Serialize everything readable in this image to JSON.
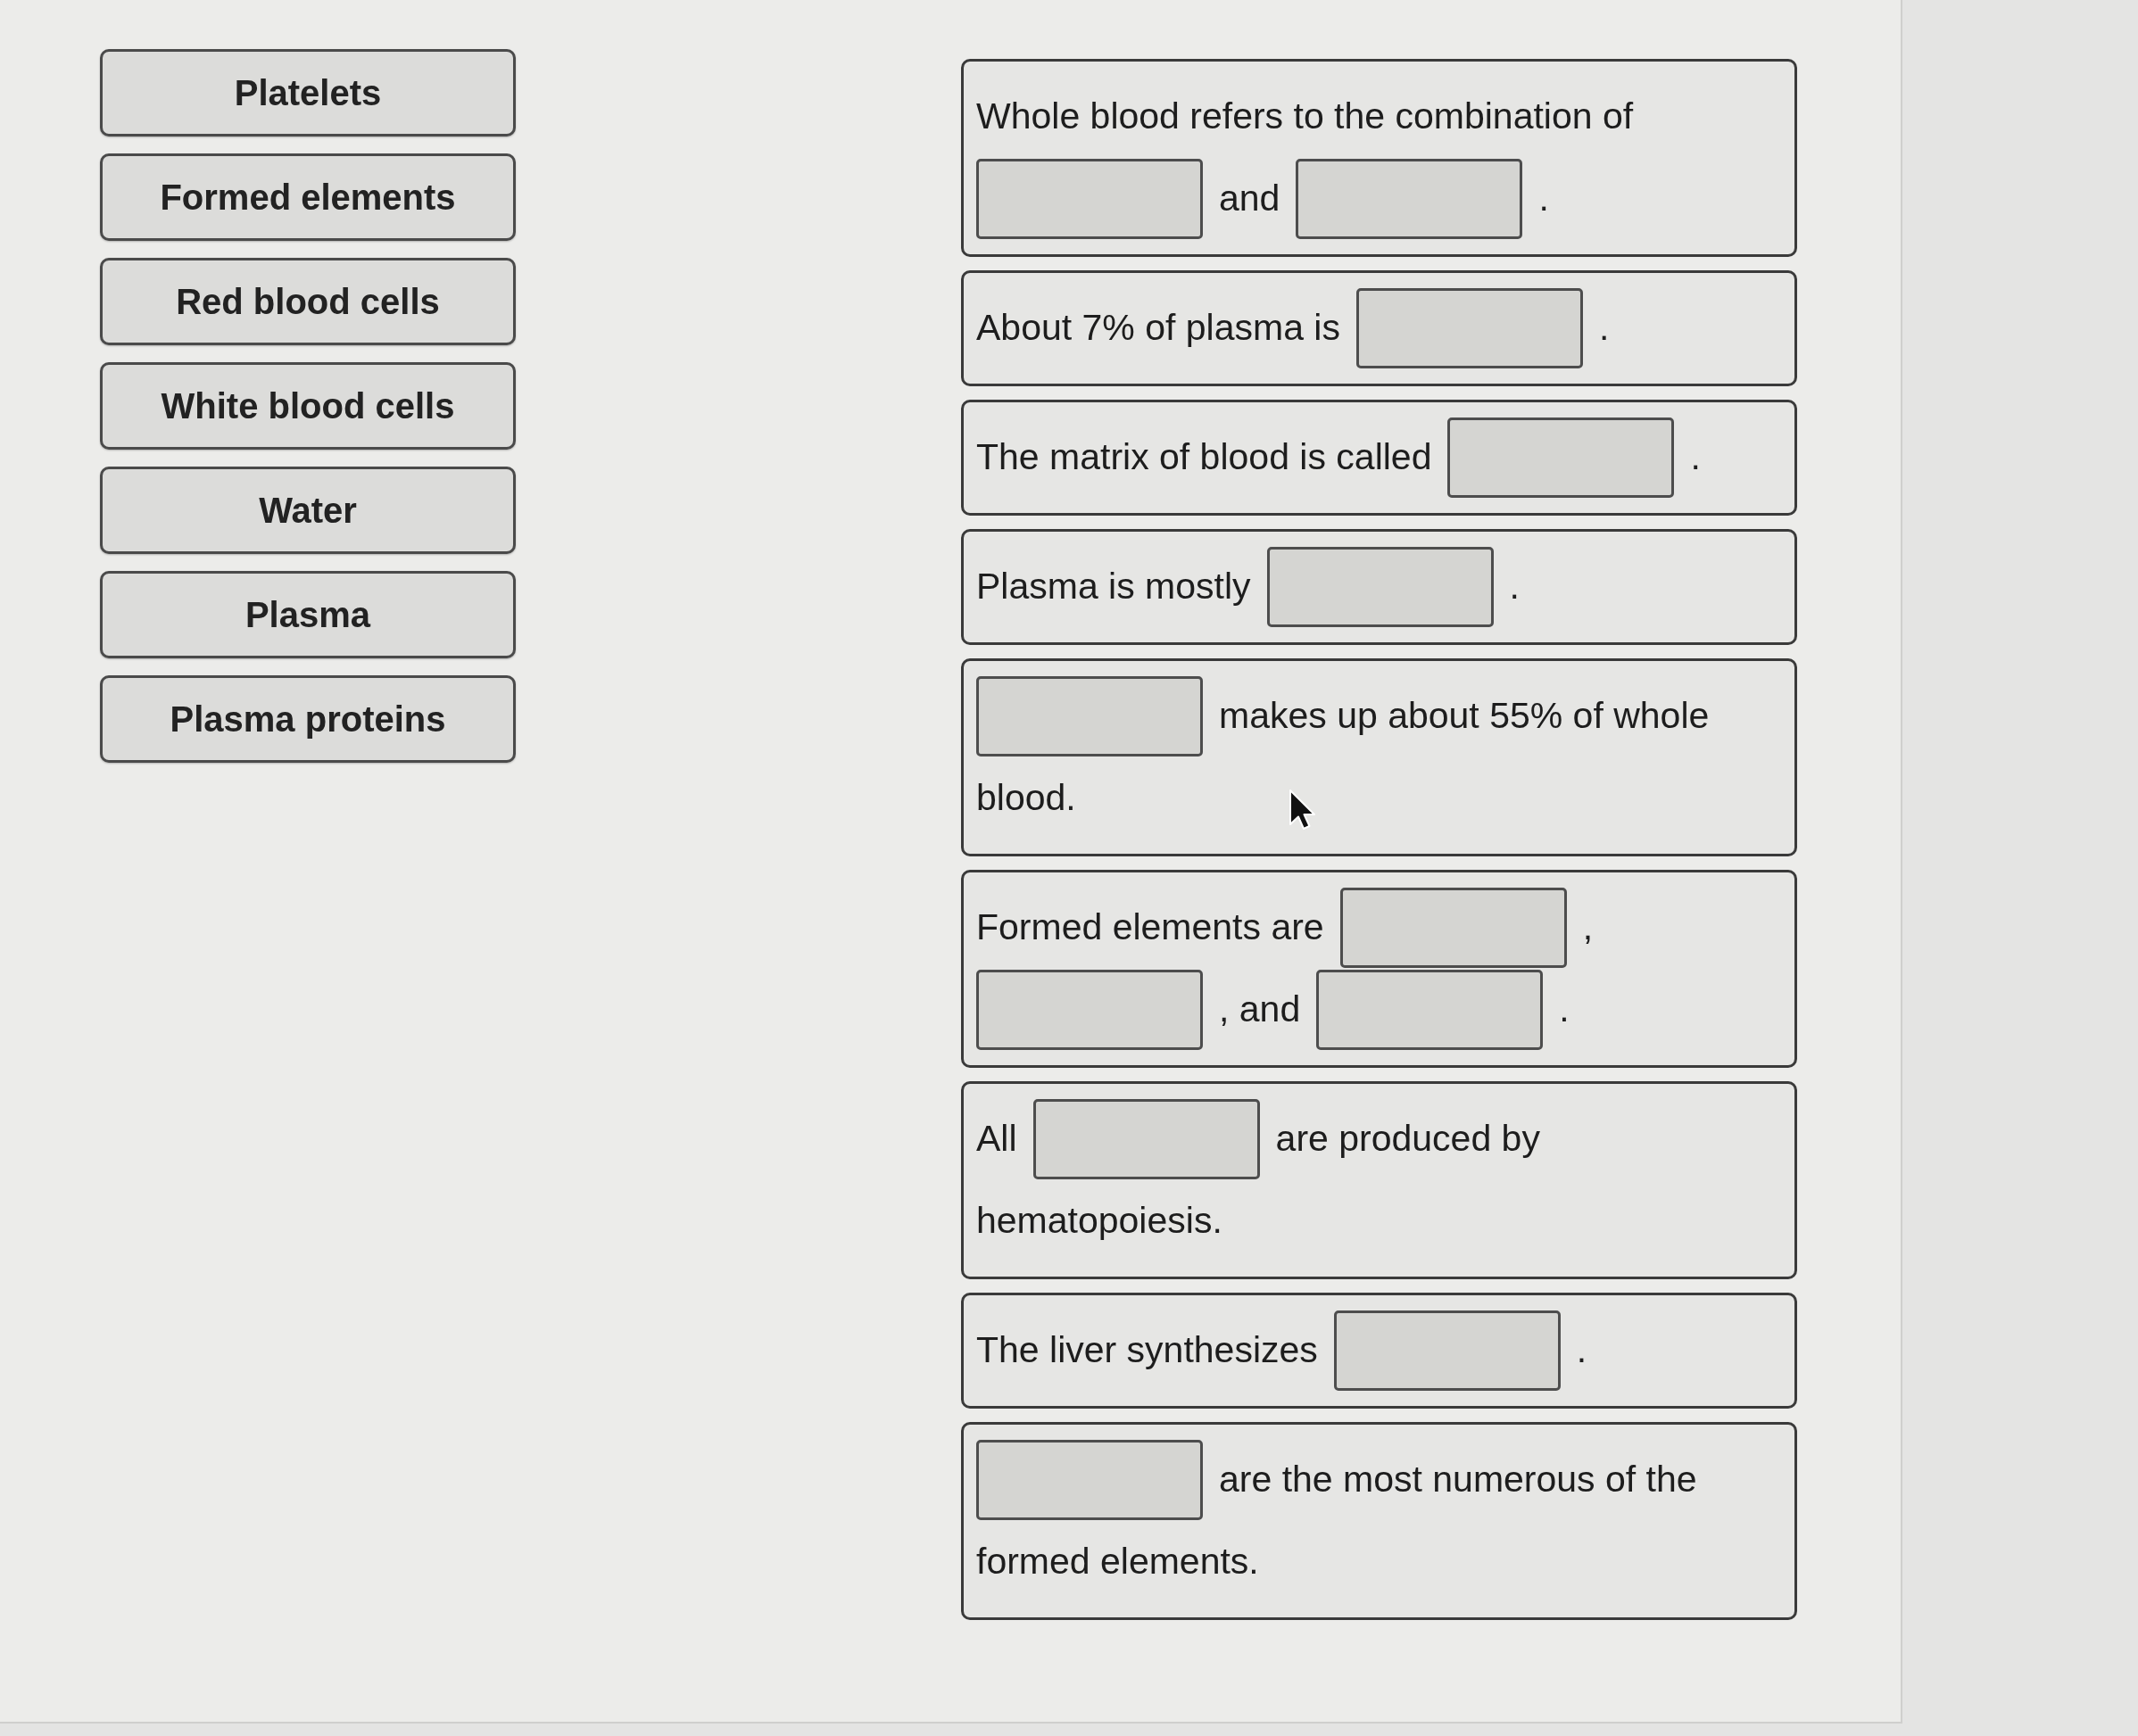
{
  "answer_tiles": [
    "Platelets",
    "Formed elements",
    "Red blood cells",
    "White blood cells",
    "Water",
    "Plasma",
    "Plasma proteins"
  ],
  "statements": [
    {
      "lines": [
        [
          {
            "kind": "text",
            "text": "Whole blood refers to the combination of"
          }
        ],
        [
          {
            "kind": "blank"
          },
          {
            "kind": "text",
            "text": "and"
          },
          {
            "kind": "blank"
          },
          {
            "kind": "text",
            "text": "."
          }
        ]
      ]
    },
    {
      "lines": [
        [
          {
            "kind": "text",
            "text": "About 7% of plasma is"
          },
          {
            "kind": "blank"
          },
          {
            "kind": "text",
            "text": "."
          }
        ]
      ]
    },
    {
      "lines": [
        [
          {
            "kind": "text",
            "text": "The matrix of blood is called"
          },
          {
            "kind": "blank"
          },
          {
            "kind": "text",
            "text": "."
          }
        ]
      ]
    },
    {
      "lines": [
        [
          {
            "kind": "text",
            "text": "Plasma is mostly"
          },
          {
            "kind": "blank"
          },
          {
            "kind": "text",
            "text": "."
          }
        ]
      ]
    },
    {
      "lines": [
        [
          {
            "kind": "blank"
          },
          {
            "kind": "text",
            "text": "makes up about 55% of whole"
          }
        ],
        [
          {
            "kind": "text",
            "text": "blood."
          }
        ]
      ]
    },
    {
      "lines": [
        [
          {
            "kind": "text",
            "text": "Formed elements are"
          },
          {
            "kind": "blank"
          },
          {
            "kind": "text",
            "text": ","
          }
        ],
        [
          {
            "kind": "blank"
          },
          {
            "kind": "text",
            "text": ", and"
          },
          {
            "kind": "blank"
          },
          {
            "kind": "text",
            "text": "."
          }
        ]
      ]
    },
    {
      "lines": [
        [
          {
            "kind": "text",
            "text": "All"
          },
          {
            "kind": "blank"
          },
          {
            "kind": "text",
            "text": "are produced by"
          }
        ],
        [
          {
            "kind": "text",
            "text": "hematopoiesis."
          }
        ]
      ]
    },
    {
      "lines": [
        [
          {
            "kind": "text",
            "text": "The liver synthesizes"
          },
          {
            "kind": "blank"
          },
          {
            "kind": "text",
            "text": "."
          }
        ]
      ]
    },
    {
      "lines": [
        [
          {
            "kind": "blank"
          },
          {
            "kind": "text",
            "text": "are the most numerous of the"
          }
        ],
        [
          {
            "kind": "text",
            "text": "formed elements."
          }
        ]
      ]
    }
  ]
}
